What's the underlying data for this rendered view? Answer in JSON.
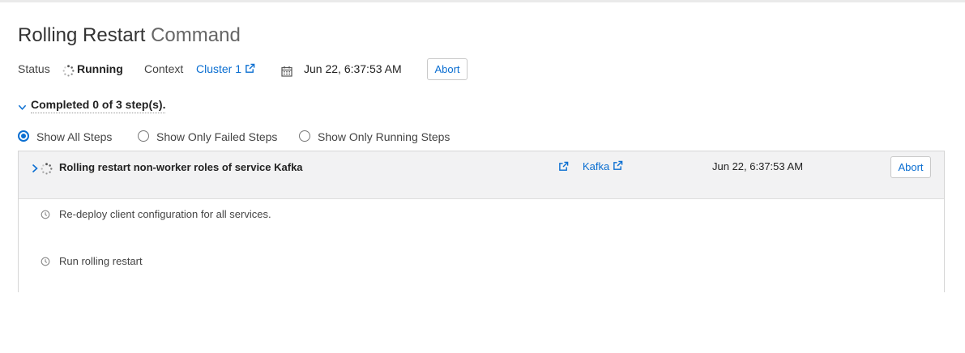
{
  "header": {
    "title_primary": "Rolling Restart",
    "title_secondary": "Command"
  },
  "meta": {
    "status_label": "Status",
    "status_value": "Running",
    "context_label": "Context",
    "context_link": "Cluster 1",
    "date": "Jun 22, 6:37:53 AM",
    "abort_label": "Abort"
  },
  "progress": {
    "label": "Completed 0 of 3 step(s)."
  },
  "filters": {
    "options": [
      {
        "label": "Show All Steps",
        "checked": true
      },
      {
        "label": "Show Only Failed Steps",
        "checked": false
      },
      {
        "label": "Show Only Running Steps",
        "checked": false
      }
    ]
  },
  "steps": {
    "main": {
      "name": "Rolling restart non-worker roles of service Kafka",
      "service_link": "Kafka",
      "time": "Jun 22, 6:37:53 AM",
      "abort_label": "Abort"
    },
    "substeps": [
      {
        "label": "Re-deploy client configuration for all services."
      },
      {
        "label": "Run rolling restart"
      }
    ]
  },
  "colors": {
    "accent": "#0a6ed1",
    "row_background": "#f2f2f3"
  },
  "icons": {
    "spinner": "spinner-icon",
    "external_link": "external-link-icon",
    "calendar": "calendar-icon",
    "chevron_down": "chevron-down-icon",
    "chevron_right": "chevron-right-icon",
    "clock": "clock-icon"
  }
}
